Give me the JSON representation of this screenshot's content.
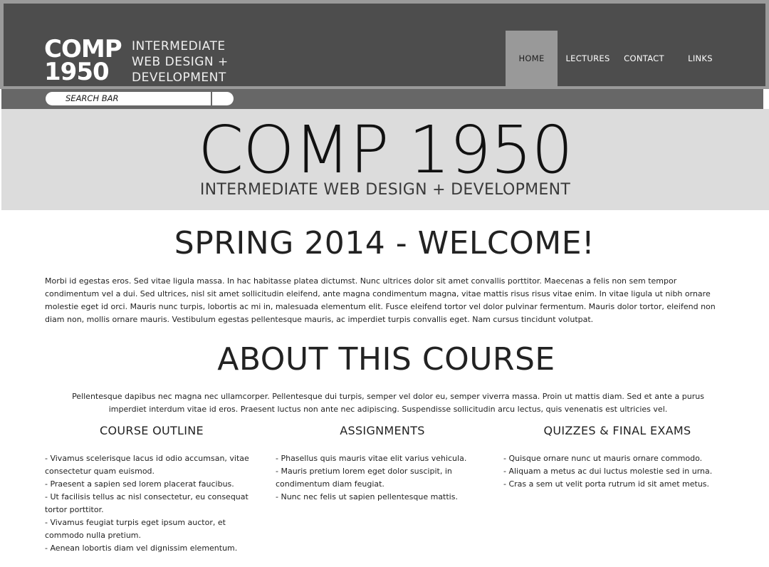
{
  "header": {
    "logo_line1": "COMP",
    "logo_line2": "1950",
    "logo_text_line1": "INTERMEDIATE",
    "logo_text_line2": "WEB DESIGN +",
    "logo_text_line3": "DEVELOPMENT",
    "nav": [
      {
        "label": "HOME",
        "active": true
      },
      {
        "label": "LECTURES"
      },
      {
        "label": "CONTACT"
      },
      {
        "label": "LINKS"
      }
    ]
  },
  "search": {
    "placeholder": "SEARCH BAR"
  },
  "hero": {
    "title": "COMP 1950",
    "subtitle": "INTERMEDIATE WEB DESIGN + DEVELOPMENT"
  },
  "welcome": {
    "heading": "SPRING 2014 - WELCOME!",
    "body": "Morbi id egestas eros. Sed vitae ligula massa. In hac habitasse platea dictumst. Nunc ultrices dolor sit amet convallis porttitor. Maecenas a felis non sem tempor condimentum vel a dui. Sed ultrices, nisl sit amet sollicitudin eleifend, ante magna condimentum magna, vitae mattis risus risus vitae enim. In vitae ligula ut nibh ornare molestie eget id orci. Mauris nunc turpis, lobortis ac mi in, malesuada elementum elit. Fusce eleifend tortor vel dolor pulvinar fermentum. Mauris dolor tortor, eleifend non diam non, mollis ornare mauris. Vestibulum egestas pellentesque mauris, ac imperdiet turpis convallis eget. Nam cursus tincidunt volutpat."
  },
  "about": {
    "heading": "ABOUT THIS COURSE",
    "body": "Pellentesque dapibus nec magna nec ullamcorper. Pellentesque dui turpis, semper vel dolor eu, semper viverra massa. Proin ut mattis diam. Sed et ante a purus imperdiet interdum vitae id eros. Praesent luctus non ante nec adipiscing. Suspendisse sollicitudin arcu lectus, quis venenatis est ultricies vel."
  },
  "columns": [
    {
      "title": "COURSE OUTLINE",
      "items": [
        "- Vivamus scelerisque lacus id odio accumsan, vitae consectetur quam euismod.",
        "- Praesent a sapien sed lorem placerat faucibus.",
        "- Ut facilisis tellus ac nisl consectetur, eu consequat tortor porttitor.",
        "- Vivamus feugiat turpis eget ipsum auctor, et commodo nulla pretium.",
        "- Aenean lobortis diam vel dignissim elementum."
      ]
    },
    {
      "title": "ASSIGNMENTS",
      "items": [
        "- Phasellus quis mauris vitae elit varius vehicula.",
        "- Mauris pretium lorem eget dolor suscipit, in condimentum diam feugiat.",
        "- Nunc nec felis ut sapien pellentesque mattis."
      ]
    },
    {
      "title": "QUIZZES & FINAL EXAMS",
      "items": [
        "- Quisque ornare nunc ut mauris ornare commodo.",
        "- Aliquam a metus ac dui luctus molestie sed in urna.",
        "- Cras a sem ut velit porta rutrum id sit amet metus."
      ]
    }
  ]
}
